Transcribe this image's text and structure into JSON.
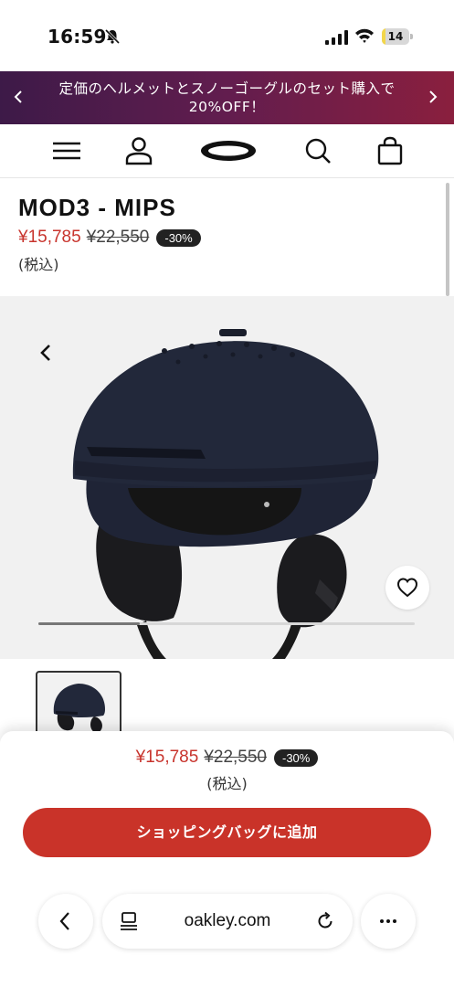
{
  "status_bar": {
    "time": "16:59",
    "battery": "14",
    "battery_level": 0.14,
    "battery_color": "#f2d64b"
  },
  "promo": {
    "text": "定価のヘルメットとスノーゴーグルのセット購入で20%OFF！",
    "gradient": [
      "#3d1a48",
      "#8a1f3e"
    ]
  },
  "nav": {
    "icons": [
      "menu-icon",
      "account-icon",
      "oakley-logo",
      "search-icon",
      "bag-icon"
    ]
  },
  "product": {
    "title": "MOD3 - MIPS",
    "sale_price": "¥15,785",
    "original_price": "¥22,550",
    "discount": "-30%",
    "tax_note": "(税込)",
    "sale_color": "#c8342d"
  },
  "gallery": {
    "progress": 0.27,
    "helmet_color": "#22283a"
  },
  "sticky": {
    "sale_price": "¥15,785",
    "original_price": "¥22,550",
    "discount": "-30%",
    "tax_note": "(税込)",
    "add_to_bag": "ショッピングバッグに追加",
    "button_color": "#c93329"
  },
  "browser": {
    "url": "oakley.com"
  }
}
